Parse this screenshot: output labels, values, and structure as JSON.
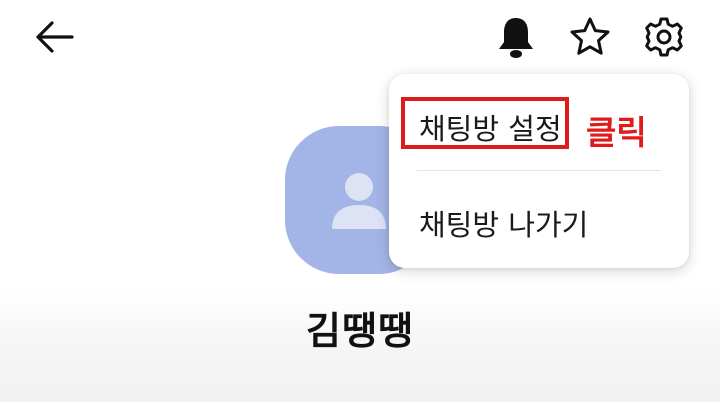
{
  "profile": {
    "name": "김땡땡"
  },
  "header": {
    "back_icon": "arrow-left-icon",
    "notification_icon": "bell-icon",
    "favorite_icon": "star-outline-icon",
    "settings_icon": "gear-icon"
  },
  "menu": {
    "items": [
      {
        "label": "채팅방 설정"
      },
      {
        "label": "채팅방 나가기"
      }
    ]
  },
  "annotation": {
    "label": "클릭",
    "color": "#e01b1b"
  },
  "colors": {
    "avatar_background": "#a3b4e6",
    "avatar_figure": "#dde3f5"
  }
}
